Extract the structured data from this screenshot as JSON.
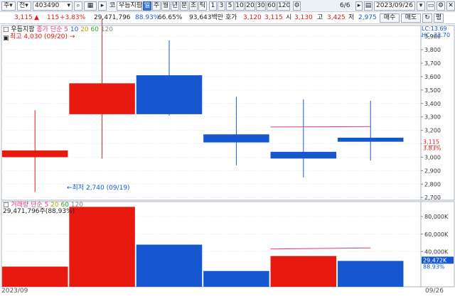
{
  "toolbar": {
    "market_select": "주",
    "type_select": "전",
    "code": "403490",
    "name_label": "코",
    "name": "우듬지팜",
    "period_buttons": [
      "일",
      "주",
      "월",
      "년",
      "분",
      "초",
      "틱"
    ],
    "selected_period": "일",
    "interval_buttons": [
      "1",
      "3",
      "5",
      "10",
      "20",
      "30",
      "60",
      "120"
    ],
    "page_count": "6/6",
    "date": "2023/09/26",
    "buy_label": "매수",
    "sell_label": "매도",
    "eval_label": "평"
  },
  "info": {
    "price": "3,115",
    "change": "115",
    "change_pct": "+3.83%",
    "volume": "29,471,796",
    "vol_ratio": "88.93%",
    "turnover": "66.65%",
    "amount": "93,643백만",
    "quote_label": "호가",
    "quote": "3,120",
    "quote2": "3,115",
    "open_label": "시",
    "open": "3,130",
    "high_label": "고",
    "high": "3,425",
    "low_label": "저",
    "low": "2,975"
  },
  "price_pane": {
    "legend_name": "우듬지팜",
    "legend_ma_label": "종가 단순",
    "legend_periods": [
      "5",
      "10",
      "20",
      "60",
      "120"
    ],
    "high_annot": "최고 4,030 (09/20)",
    "low_annot": "최저 2,740 (09/19)",
    "lc_label": "LC:13.69",
    "hc_label": "HC:-22.70",
    "current_price_tag": "3,115",
    "current_pct_tag": "3.83%",
    "yticks": [
      "3,900",
      "3,800",
      "3,700",
      "3,600",
      "3,500",
      "3,400",
      "3,300",
      "3,200",
      "3,100",
      "3,000",
      "2,900",
      "2,800",
      "2,700"
    ]
  },
  "volume_pane": {
    "legend_label": "거래량 단순",
    "legend_periods": [
      "5",
      "20",
      "60",
      "120"
    ],
    "volume_text": "29,471,796주(88,93%)",
    "yticks": [
      "80,000K",
      "60,000K",
      "40,000K"
    ],
    "current_vol_tag": "29,472K",
    "current_ratio_tag": "88.93%"
  },
  "xaxis": {
    "left_label": "2023/09",
    "right_label": "09/26"
  },
  "colors": {
    "up": "#e8190f",
    "down": "#1657cf",
    "ma": "#e2368a",
    "grid": "#e4e4e4"
  },
  "chart_data": {
    "type": "candlestick",
    "ylim": [
      2680,
      3980
    ],
    "candles": [
      {
        "open": 3050,
        "high": 3350,
        "low": 2740,
        "close": 3000,
        "up": true
      },
      {
        "open": 3320,
        "high": 4030,
        "low": 2990,
        "close": 3550,
        "up": true
      },
      {
        "open": 3610,
        "high": 3870,
        "low": 3310,
        "close": 3320,
        "up": false
      },
      {
        "open": 3170,
        "high": 3450,
        "low": 2940,
        "close": 3110,
        "up": false
      },
      {
        "open": 3040,
        "high": 3430,
        "low": 2850,
        "close": 2990,
        "up": false
      },
      {
        "open": 3145,
        "high": 3420,
        "low": 2975,
        "close": 3115,
        "up": false
      }
    ],
    "ma5": [
      null,
      null,
      null,
      null,
      3225,
      3228
    ],
    "volume": {
      "ylim": [
        0,
        97000
      ],
      "values": [
        23000,
        91000,
        48000,
        18000,
        35000,
        29472
      ],
      "up": [
        true,
        true,
        false,
        false,
        true,
        false
      ],
      "ma5": [
        null,
        null,
        null,
        null,
        43000,
        44300
      ]
    }
  }
}
